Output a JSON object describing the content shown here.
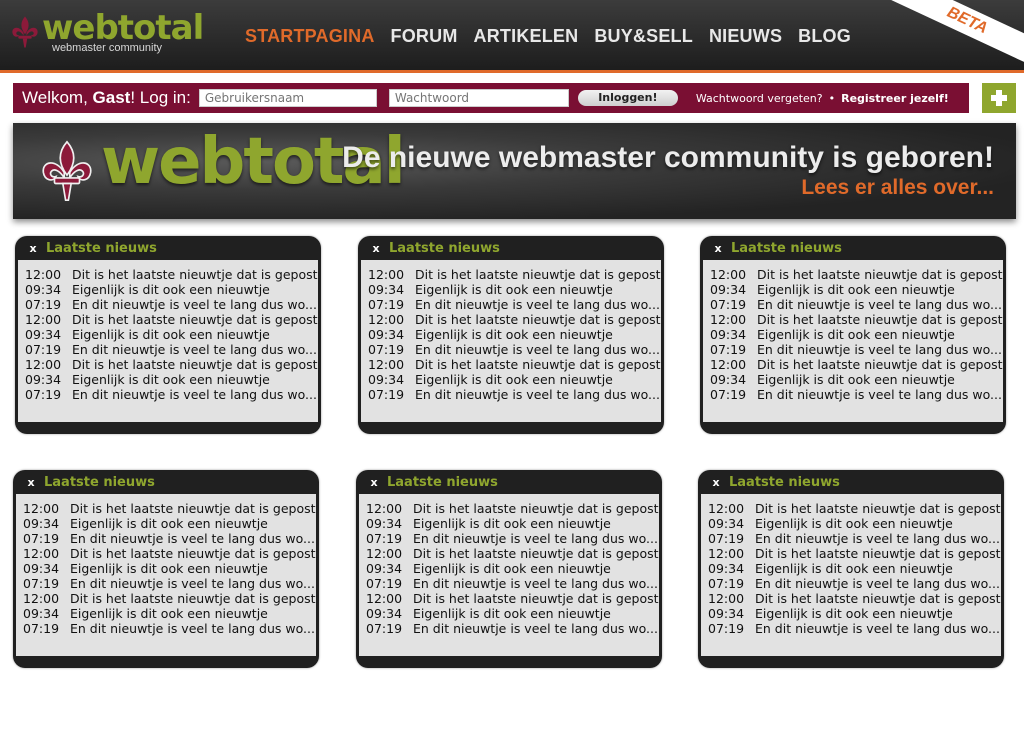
{
  "brand": {
    "name": "webtotal",
    "tagline": "webmaster community",
    "badge": "BETA",
    "colors": {
      "green": "#8fa62e",
      "orange": "#e06a2a",
      "maroon": "#7a0f33",
      "dark": "#202020"
    }
  },
  "nav": {
    "items": [
      {
        "label": "STARTPAGINA",
        "active": true
      },
      {
        "label": "FORUM",
        "active": false
      },
      {
        "label": "ARTIKELEN",
        "active": false
      },
      {
        "label": "BUY&SELL",
        "active": false
      },
      {
        "label": "NIEUWS",
        "active": false
      },
      {
        "label": "BLOG",
        "active": false
      }
    ]
  },
  "login": {
    "welcome_prefix": "Welkom, ",
    "welcome_user": "Gast",
    "welcome_suffix": "! Log in:",
    "username_placeholder": "Gebruikersnaam",
    "password_placeholder": "Wachtwoord",
    "button_label": "Inloggen!",
    "forgot_link": "Wachtwoord vergeten?",
    "separator": "•",
    "register_link": "Registreer jezelf!",
    "add_icon": "plus-icon"
  },
  "banner": {
    "logo_text": "webtotal",
    "headline": "De nieuwe webmaster community is geboren!",
    "cta": "Lees er alles over..."
  },
  "widgets": [
    {
      "close": "x",
      "title": "Laatste nieuws",
      "items": [
        {
          "time": "12:00",
          "text": "Dit is het laatste nieuwtje dat is gepost"
        },
        {
          "time": "09:34",
          "text": "Eigenlijk is dit ook een nieuwtje"
        },
        {
          "time": "07:19",
          "text": "En dit nieuwtje is veel te lang dus wo..."
        },
        {
          "time": "12:00",
          "text": "Dit is het laatste nieuwtje dat is gepost"
        },
        {
          "time": "09:34",
          "text": "Eigenlijk is dit ook een nieuwtje"
        },
        {
          "time": "07:19",
          "text": "En dit nieuwtje is veel te lang dus wo..."
        },
        {
          "time": "12:00",
          "text": "Dit is het laatste nieuwtje dat is gepost"
        },
        {
          "time": "09:34",
          "text": "Eigenlijk is dit ook een nieuwtje"
        },
        {
          "time": "07:19",
          "text": "En dit nieuwtje is veel te lang dus wo..."
        }
      ]
    },
    {
      "close": "x",
      "title": "Laatste nieuws",
      "items": [
        {
          "time": "12:00",
          "text": "Dit is het laatste nieuwtje dat is gepost"
        },
        {
          "time": "09:34",
          "text": "Eigenlijk is dit ook een nieuwtje"
        },
        {
          "time": "07:19",
          "text": "En dit nieuwtje is veel te lang dus wo..."
        },
        {
          "time": "12:00",
          "text": "Dit is het laatste nieuwtje dat is gepost"
        },
        {
          "time": "09:34",
          "text": "Eigenlijk is dit ook een nieuwtje"
        },
        {
          "time": "07:19",
          "text": "En dit nieuwtje is veel te lang dus wo..."
        },
        {
          "time": "12:00",
          "text": "Dit is het laatste nieuwtje dat is gepost"
        },
        {
          "time": "09:34",
          "text": "Eigenlijk is dit ook een nieuwtje"
        },
        {
          "time": "07:19",
          "text": "En dit nieuwtje is veel te lang dus wo..."
        }
      ]
    },
    {
      "close": "x",
      "title": "Laatste nieuws",
      "items": [
        {
          "time": "12:00",
          "text": "Dit is het laatste nieuwtje dat is gepost"
        },
        {
          "time": "09:34",
          "text": "Eigenlijk is dit ook een nieuwtje"
        },
        {
          "time": "07:19",
          "text": "En dit nieuwtje is veel te lang dus wo..."
        },
        {
          "time": "12:00",
          "text": "Dit is het laatste nieuwtje dat is gepost"
        },
        {
          "time": "09:34",
          "text": "Eigenlijk is dit ook een nieuwtje"
        },
        {
          "time": "07:19",
          "text": "En dit nieuwtje is veel te lang dus wo..."
        },
        {
          "time": "12:00",
          "text": "Dit is het laatste nieuwtje dat is gepost"
        },
        {
          "time": "09:34",
          "text": "Eigenlijk is dit ook een nieuwtje"
        },
        {
          "time": "07:19",
          "text": "En dit nieuwtje is veel te lang dus wo..."
        }
      ]
    },
    {
      "close": "x",
      "title": "Laatste nieuws",
      "items": [
        {
          "time": "12:00",
          "text": "Dit is het laatste nieuwtje dat is gepost"
        },
        {
          "time": "09:34",
          "text": "Eigenlijk is dit ook een nieuwtje"
        },
        {
          "time": "07:19",
          "text": "En dit nieuwtje is veel te lang dus wo..."
        },
        {
          "time": "12:00",
          "text": "Dit is het laatste nieuwtje dat is gepost"
        },
        {
          "time": "09:34",
          "text": "Eigenlijk is dit ook een nieuwtje"
        },
        {
          "time": "07:19",
          "text": "En dit nieuwtje is veel te lang dus wo..."
        },
        {
          "time": "12:00",
          "text": "Dit is het laatste nieuwtje dat is gepost"
        },
        {
          "time": "09:34",
          "text": "Eigenlijk is dit ook een nieuwtje"
        },
        {
          "time": "07:19",
          "text": "En dit nieuwtje is veel te lang dus wo..."
        }
      ]
    },
    {
      "close": "x",
      "title": "Laatste nieuws",
      "items": [
        {
          "time": "12:00",
          "text": "Dit is het laatste nieuwtje dat is gepost"
        },
        {
          "time": "09:34",
          "text": "Eigenlijk is dit ook een nieuwtje"
        },
        {
          "time": "07:19",
          "text": "En dit nieuwtje is veel te lang dus wo..."
        },
        {
          "time": "12:00",
          "text": "Dit is het laatste nieuwtje dat is gepost"
        },
        {
          "time": "09:34",
          "text": "Eigenlijk is dit ook een nieuwtje"
        },
        {
          "time": "07:19",
          "text": "En dit nieuwtje is veel te lang dus wo..."
        },
        {
          "time": "12:00",
          "text": "Dit is het laatste nieuwtje dat is gepost"
        },
        {
          "time": "09:34",
          "text": "Eigenlijk is dit ook een nieuwtje"
        },
        {
          "time": "07:19",
          "text": "En dit nieuwtje is veel te lang dus wo..."
        }
      ]
    },
    {
      "close": "x",
      "title": "Laatste nieuws",
      "items": [
        {
          "time": "12:00",
          "text": "Dit is het laatste nieuwtje dat is gepost"
        },
        {
          "time": "09:34",
          "text": "Eigenlijk is dit ook een nieuwtje"
        },
        {
          "time": "07:19",
          "text": "En dit nieuwtje is veel te lang dus wo..."
        },
        {
          "time": "12:00",
          "text": "Dit is het laatste nieuwtje dat is gepost"
        },
        {
          "time": "09:34",
          "text": "Eigenlijk is dit ook een nieuwtje"
        },
        {
          "time": "07:19",
          "text": "En dit nieuwtje is veel te lang dus wo..."
        },
        {
          "time": "12:00",
          "text": "Dit is het laatste nieuwtje dat is gepost"
        },
        {
          "time": "09:34",
          "text": "Eigenlijk is dit ook een nieuwtje"
        },
        {
          "time": "07:19",
          "text": "En dit nieuwtje is veel te lang dus wo..."
        }
      ]
    }
  ]
}
